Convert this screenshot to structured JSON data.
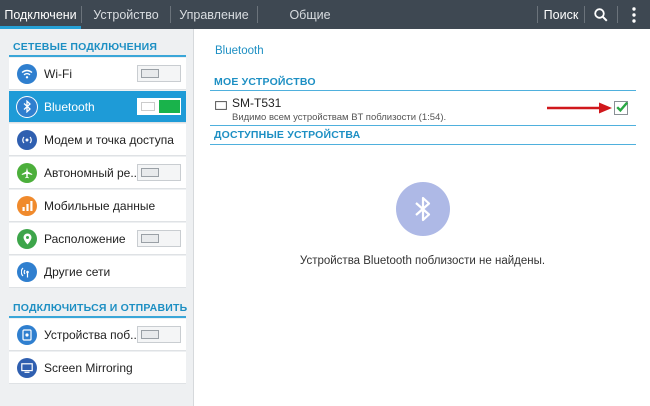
{
  "topbar": {
    "tabs": [
      {
        "label": "Подключени"
      },
      {
        "label": "Устройство"
      },
      {
        "label": "Управление"
      },
      {
        "label": "Общие"
      }
    ],
    "search_label": "Поиск"
  },
  "sidebar": {
    "section1_title": "СЕТЕВЫЕ ПОДКЛЮЧЕНИЯ",
    "section2_title": "ПОДКЛЮЧИТЬСЯ И ОТПРАВИТЬ",
    "items": [
      {
        "label": "Wi-Fi",
        "icon": "wifi-icon",
        "color": "#2f7fcf",
        "toggle": "off"
      },
      {
        "label": "Bluetooth",
        "icon": "bluetooth-icon",
        "color": "#2f7fcf",
        "toggle": "on"
      },
      {
        "label": "Модем и точка доступа",
        "icon": "hotspot-icon",
        "color": "#2f5fb0"
      },
      {
        "label": "Автономный ре...",
        "icon": "airplane-icon",
        "color": "#4caf3b",
        "toggle": "off"
      },
      {
        "label": "Мобильные данные",
        "icon": "data-usage-icon",
        "color": "#f08a2c"
      },
      {
        "label": "Расположение",
        "icon": "location-icon",
        "color": "#3da54a",
        "toggle": "off"
      },
      {
        "label": "Другие сети",
        "icon": "more-networks-icon",
        "color": "#2f7fcf"
      },
      {
        "label": "Устройства поб...",
        "icon": "nearby-devices-icon",
        "color": "#2f7fcf",
        "toggle": "off"
      },
      {
        "label": "Screen Mirroring",
        "icon": "screen-mirroring-icon",
        "color": "#2f5fb0"
      }
    ]
  },
  "main": {
    "title": "Bluetooth",
    "my_device_header": "МОЕ УСТРОЙСТВО",
    "device_name": "SM-T531",
    "device_status": "Видимо всем устройствам BT поблизости (1:54).",
    "available_header": "ДОСТУПНЫЕ УСТРОЙСТВА",
    "empty_message": "Устройства Bluetooth поблизости не найдены."
  },
  "colors": {
    "accent": "#1d8fc3",
    "selected": "#1e9bd7",
    "toggle_on": "#19b34b",
    "checkmark": "#2aa845",
    "arrow": "#d0181c"
  }
}
